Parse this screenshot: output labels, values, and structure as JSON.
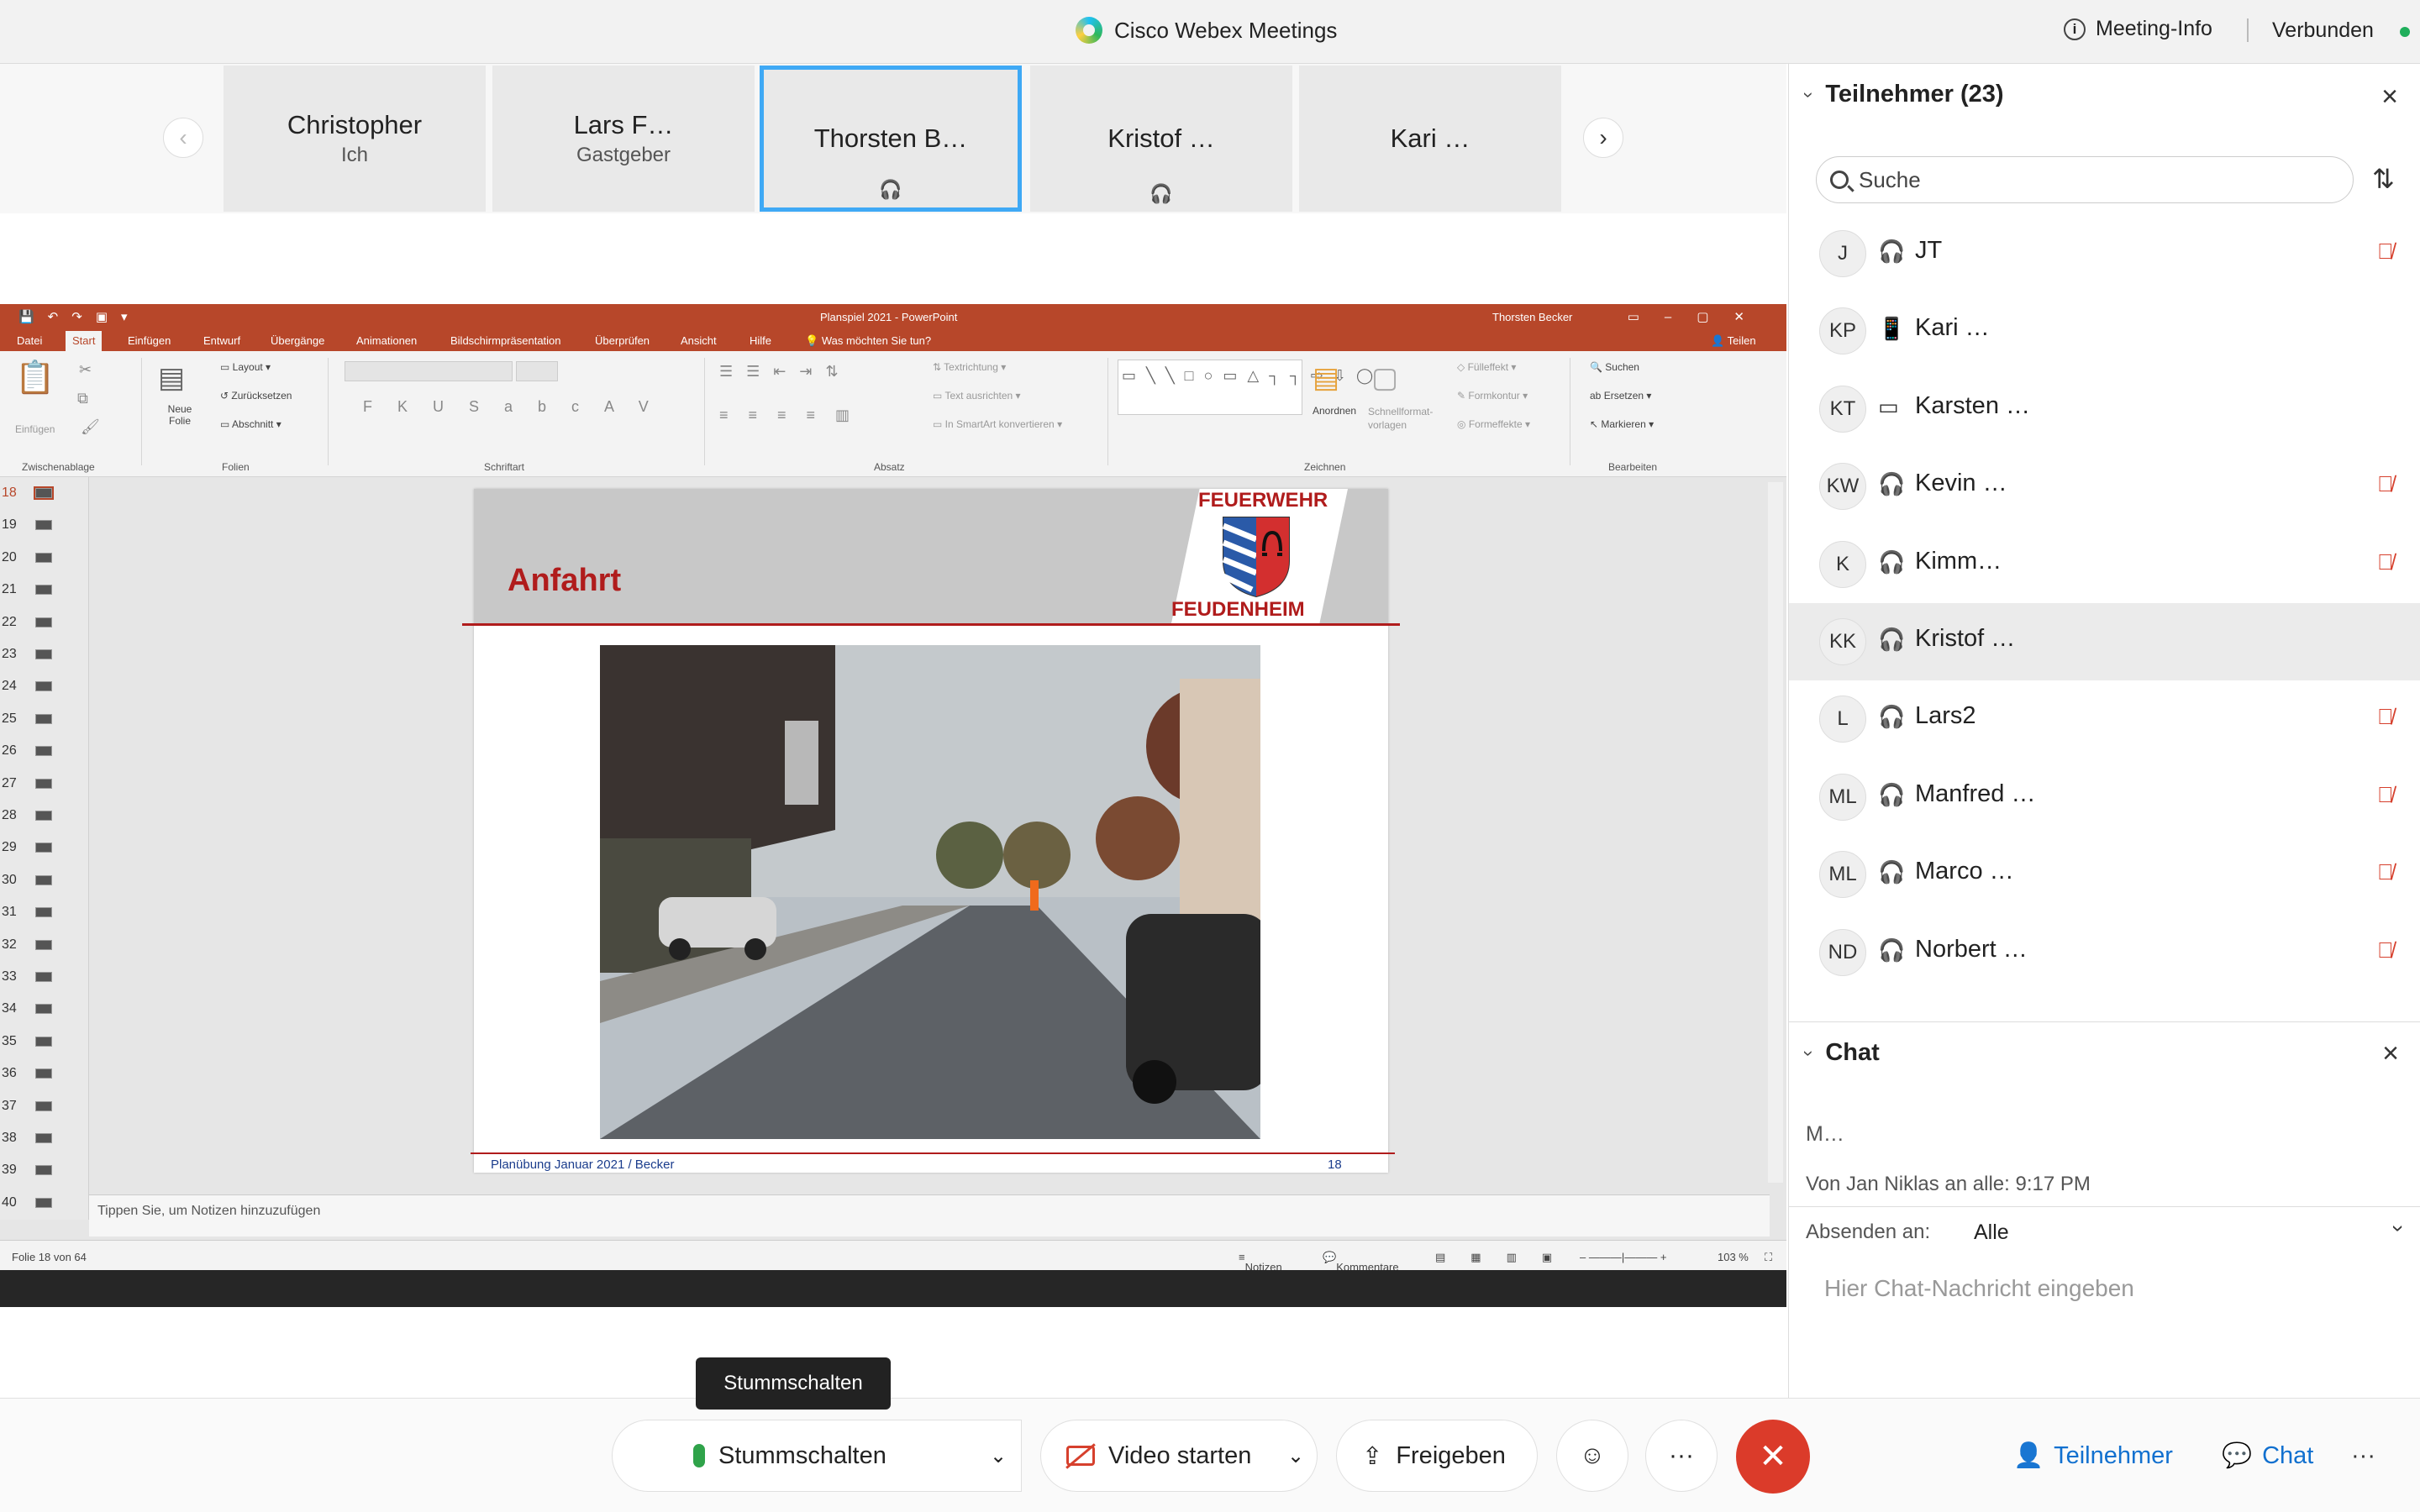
{
  "titlebar": {
    "app_title": "Cisco Webex Meetings",
    "meeting_info": "Meeting-Info",
    "status": "Verbunden",
    "status_color": "#1fae5b"
  },
  "thumbnails": [
    {
      "name": "Christopher",
      "role": "Ich"
    },
    {
      "name": "Lars F…",
      "role": "Gastgeber"
    },
    {
      "name": "Thorsten B…",
      "role": ""
    },
    {
      "name": "Kristof …",
      "role": ""
    },
    {
      "name": "Kari …",
      "role": ""
    }
  ],
  "powerpoint": {
    "window_title": "Planspiel 2021 - PowerPoint",
    "user": "Thorsten Becker",
    "tabs": [
      "Datei",
      "Start",
      "Einfügen",
      "Entwurf",
      "Übergänge",
      "Animationen",
      "Bildschirmpräsentation",
      "Überprüfen",
      "Ansicht",
      "Hilfe",
      "Was möchten Sie tun?"
    ],
    "share": "Teilen",
    "ribbon": {
      "groups": [
        "Zwischenablage",
        "Folien",
        "Schriftart",
        "Absatz",
        "Zeichnen",
        "Bearbeiten"
      ],
      "einfuegen": "Einfügen",
      "neue_folie": "Neue Folie",
      "layout": "Layout",
      "zuruecksetzen": "Zurücksetzen",
      "abschnitt": "Abschnitt",
      "textrichtung": "Textrichtung",
      "text_ausrichten": "Text ausrichten",
      "smartart": "In SmartArt konvertieren",
      "anordnen": "Anordnen",
      "schnellformat": "Schnellformat-vorlagen",
      "fuelleffekt": "Fülleffekt",
      "formkontur": "Formkontur",
      "formeffekte": "Formeffekte",
      "suchen": "Suchen",
      "ersetzen": "Ersetzen",
      "markieren": "Markieren"
    },
    "slide_numbers": [
      "18",
      "19",
      "20",
      "21",
      "22",
      "23",
      "24",
      "25",
      "26",
      "27",
      "28",
      "29",
      "30",
      "31",
      "32",
      "33",
      "34",
      "35",
      "36",
      "37",
      "38",
      "39",
      "40"
    ],
    "slide": {
      "title": "Anfahrt",
      "logo_top": "FEUERWEHR",
      "logo_bottom": "FEUDENHEIM",
      "footer": "Planübung Januar 2021 / Becker",
      "number": "18"
    },
    "notes_placeholder": "Tippen Sie, um Notizen hinzuzufügen",
    "status": {
      "slide_of": "Folie 18 von 64",
      "notes": "Notizen",
      "comments": "Kommentare",
      "zoom": "103 %"
    }
  },
  "participants_panel": {
    "title": "Teilnehmer (23)",
    "search_placeholder": "Suche",
    "participants": [
      {
        "initials": "J",
        "name": "JT",
        "device": "headset",
        "muted": true,
        "highlight": false
      },
      {
        "initials": "KP",
        "name": "Kari …",
        "device": "phone",
        "muted": false,
        "highlight": false
      },
      {
        "initials": "KT",
        "name": "Karsten …",
        "device": "tablet",
        "muted": false,
        "highlight": false
      },
      {
        "initials": "KW",
        "name": "Kevin …",
        "device": "headset",
        "muted": true,
        "highlight": false
      },
      {
        "initials": "K",
        "name": "Kimm…",
        "device": "headset",
        "muted": true,
        "highlight": false
      },
      {
        "initials": "KK",
        "name": "Kristof …",
        "device": "headset",
        "muted": false,
        "highlight": true
      },
      {
        "initials": "L",
        "name": "Lars2",
        "device": "headset",
        "muted": true,
        "highlight": false
      },
      {
        "initials": "ML",
        "name": "Manfred …",
        "device": "headset",
        "muted": true,
        "highlight": false
      },
      {
        "initials": "ML",
        "name": "Marco …",
        "device": "headset",
        "muted": true,
        "highlight": false
      },
      {
        "initials": "ND",
        "name": "Norbert …",
        "device": "headset",
        "muted": true,
        "highlight": false
      }
    ]
  },
  "chat_panel": {
    "title": "Chat",
    "last_message": "M…",
    "meta": "Von Jan Niklas an alle:   9:17  PM",
    "send_to_label": "Absenden an:",
    "send_to_value": "Alle",
    "input_placeholder": "Hier Chat-Nachricht eingeben"
  },
  "bottom_bar": {
    "tooltip": "Stummschalten",
    "mute": "Stummschalten",
    "video": "Video starten",
    "share": "Freigeben",
    "participants": "Teilnehmer",
    "chat": "Chat",
    "end_color": "#db3b2a"
  }
}
